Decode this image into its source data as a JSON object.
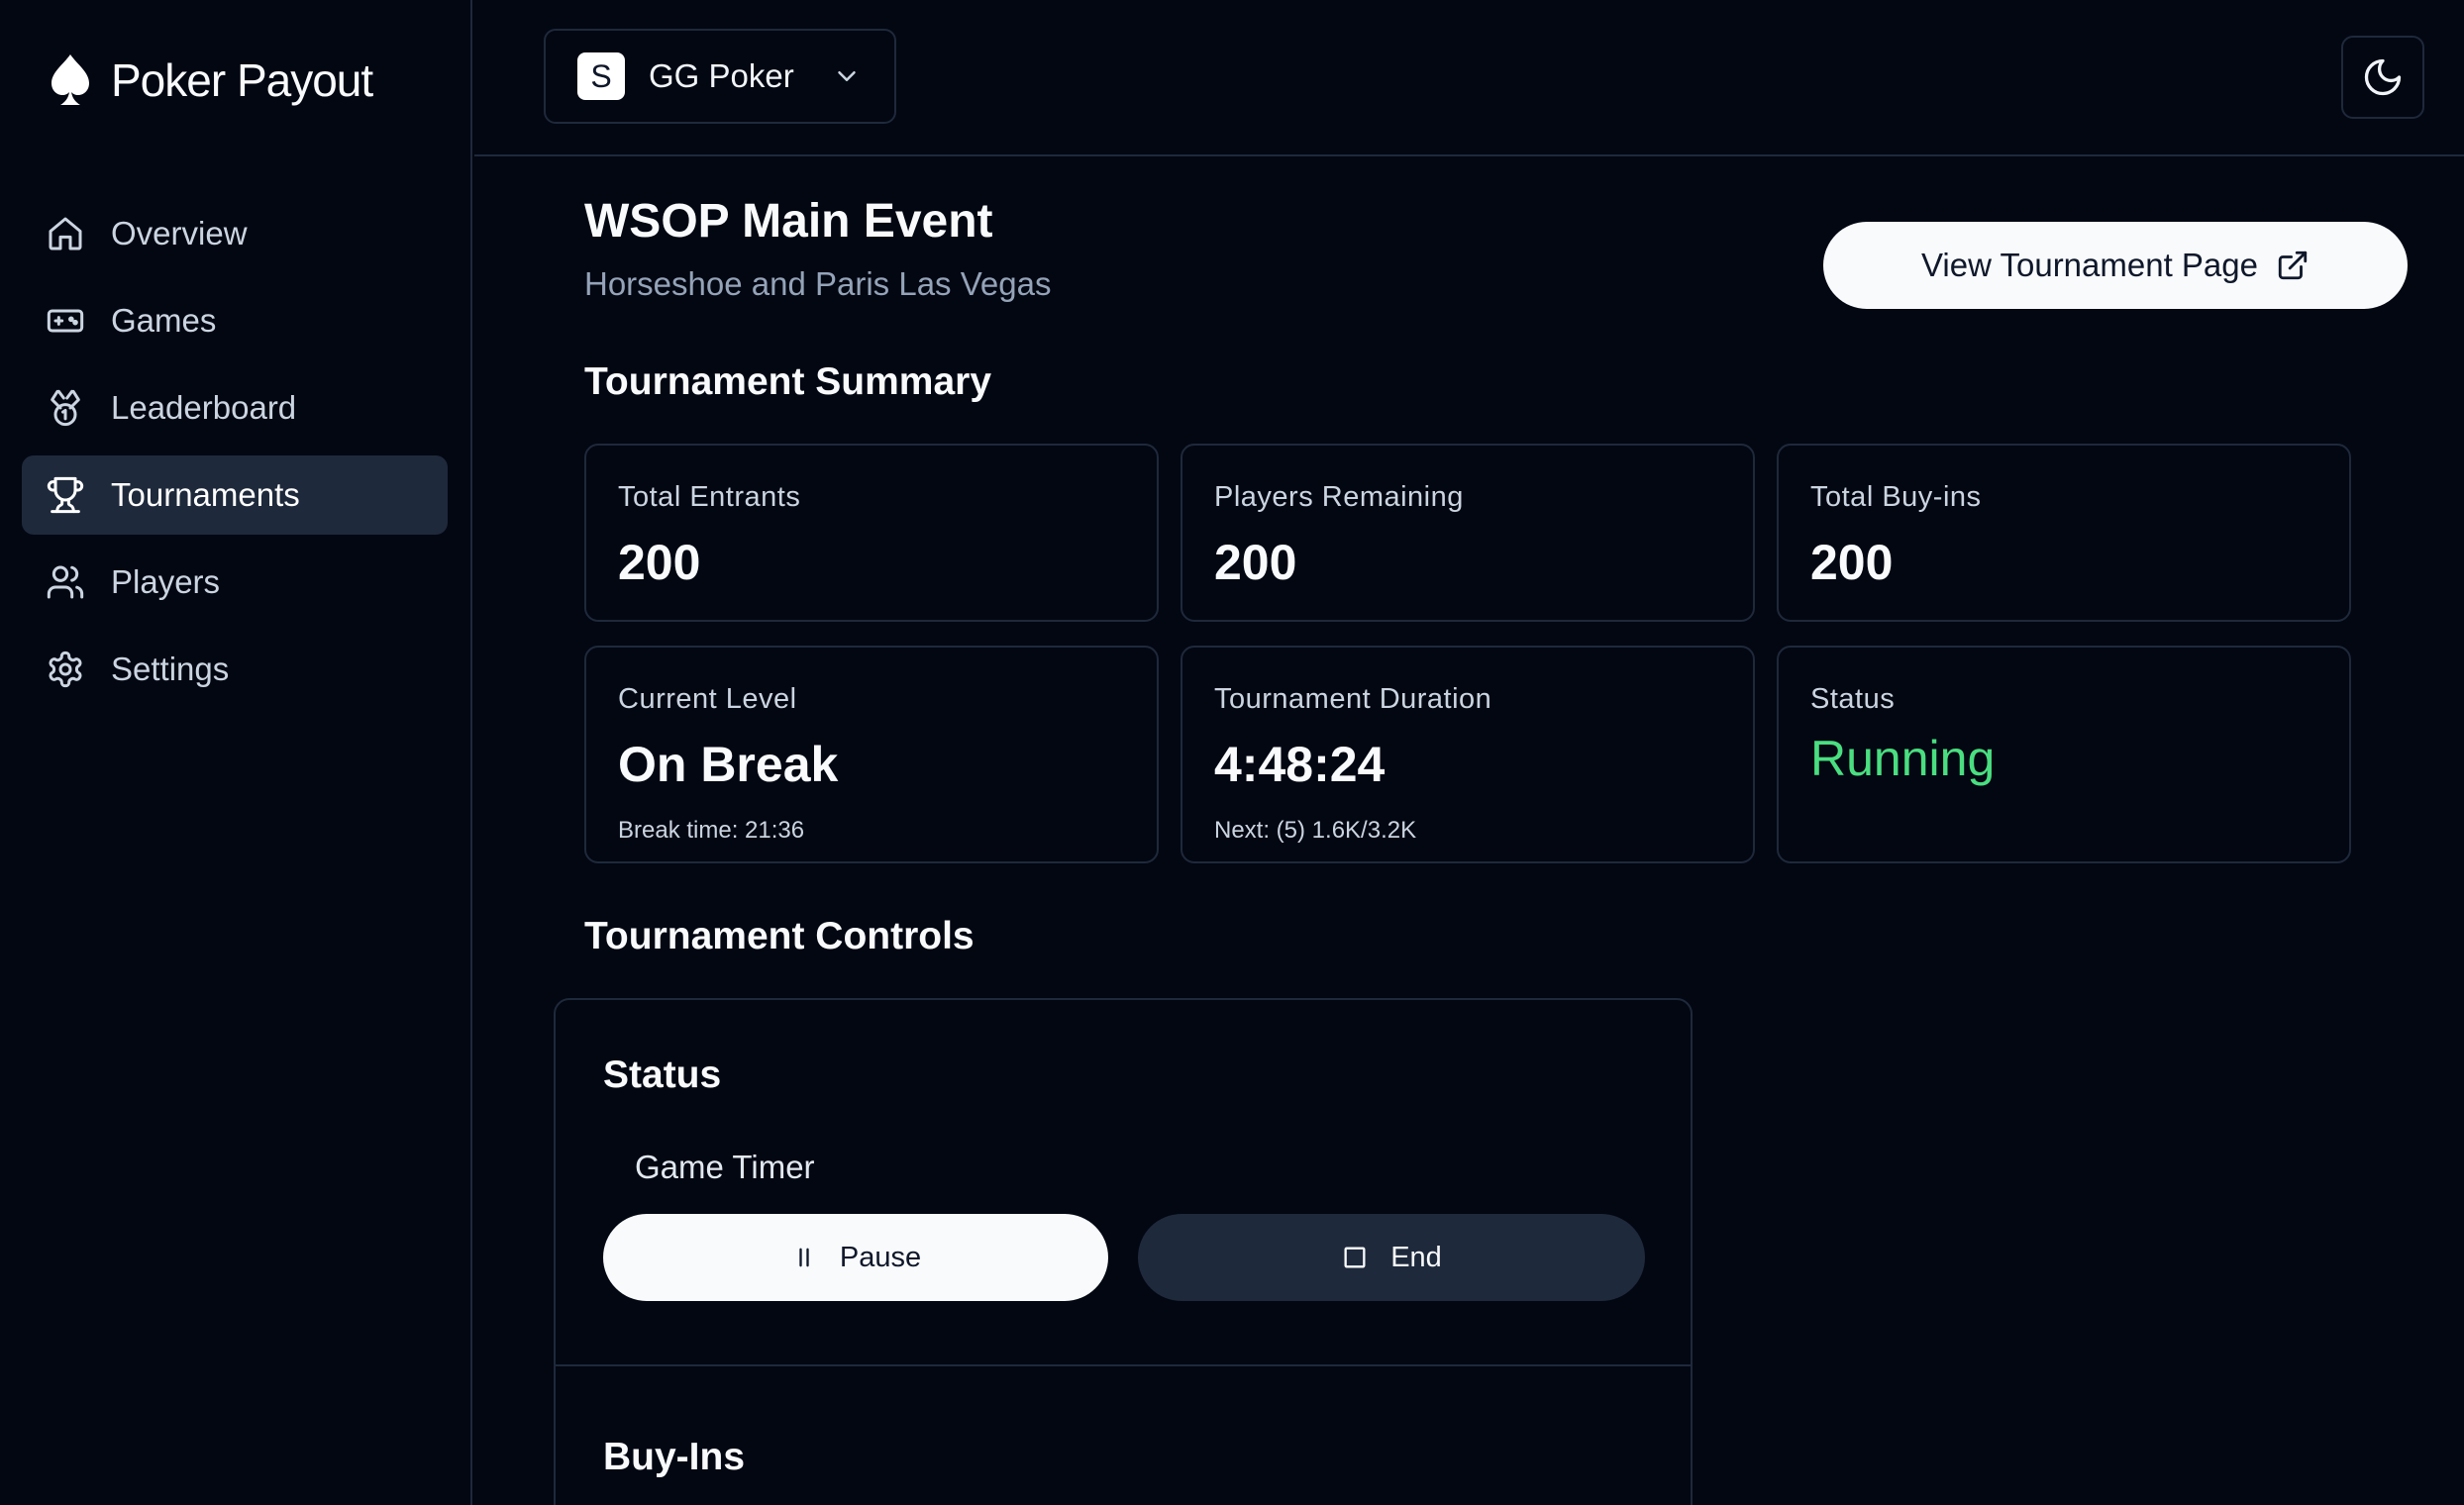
{
  "brand": {
    "name": "Poker Payout"
  },
  "nav": {
    "items": [
      {
        "label": "Overview",
        "icon": "home-icon"
      },
      {
        "label": "Games",
        "icon": "gamepad-icon"
      },
      {
        "label": "Leaderboard",
        "icon": "medal-icon"
      },
      {
        "label": "Tournaments",
        "icon": "trophy-icon",
        "active": true
      },
      {
        "label": "Players",
        "icon": "users-icon"
      },
      {
        "label": "Settings",
        "icon": "gear-icon"
      }
    ]
  },
  "header": {
    "site": {
      "badge": "S",
      "name": "GG Poker"
    },
    "theme_icon": "moon-icon"
  },
  "tournament": {
    "title": "WSOP Main Event",
    "venue": "Horseshoe and Paris Las Vegas",
    "view_button": "View Tournament Page"
  },
  "summary": {
    "heading": "Tournament Summary",
    "cards": [
      {
        "label": "Total Entrants",
        "value": "200"
      },
      {
        "label": "Players Remaining",
        "value": "200"
      },
      {
        "label": "Total Buy-ins",
        "value": "200"
      },
      {
        "label": "Current Level",
        "value": "On Break",
        "note": "Break time: 21:36"
      },
      {
        "label": "Tournament Duration",
        "value": "4:48:24",
        "note": "Next: (5) 1.6K/3.2K"
      },
      {
        "label": "Status",
        "value": "Running"
      }
    ]
  },
  "controls": {
    "heading": "Tournament Controls",
    "status_heading": "Status",
    "timer_label": "Game Timer",
    "pause_label": "Pause",
    "end_label": "End",
    "buyins_heading": "Buy-Ins"
  },
  "colors": {
    "accent_green": "#4ade80",
    "background": "#030712",
    "border": "#1e293b"
  }
}
